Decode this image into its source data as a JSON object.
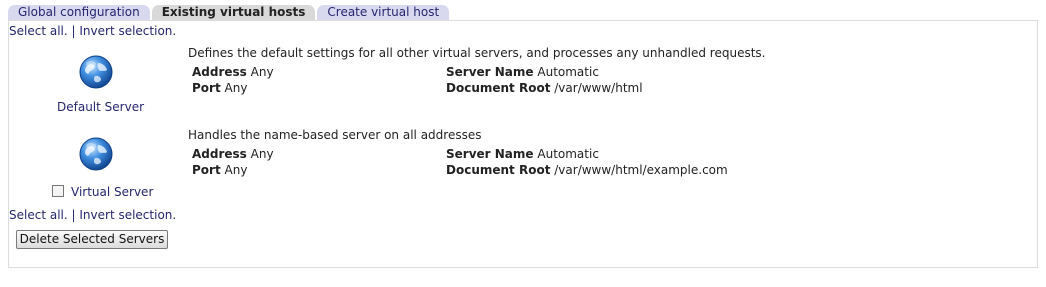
{
  "tabs": [
    {
      "label": "Global configuration",
      "active": false
    },
    {
      "label": "Existing virtual hosts",
      "active": true
    },
    {
      "label": "Create virtual host",
      "active": false
    }
  ],
  "selection_links": {
    "select_all": "Select all.",
    "separator": "|",
    "invert": "Invert selection."
  },
  "servers": [
    {
      "name": "Default Server",
      "icon": "globe-icon",
      "has_checkbox": false,
      "description": "Defines the default settings for all other virtual servers, and processes any unhandled requests.",
      "address_label": "Address",
      "address_value": "Any",
      "port_label": "Port",
      "port_value": "Any",
      "server_name_label": "Server Name",
      "server_name_value": "Automatic",
      "doc_root_label": "Document Root",
      "doc_root_value": "/var/www/html"
    },
    {
      "name": "Virtual Server",
      "icon": "globe-icon",
      "has_checkbox": true,
      "checked": false,
      "description": "Handles the name-based server on all addresses",
      "address_label": "Address",
      "address_value": "Any",
      "port_label": "Port",
      "port_value": "Any",
      "server_name_label": "Server Name",
      "server_name_value": "Automatic",
      "doc_root_label": "Document Root",
      "doc_root_value": "/var/www/html/example.com"
    }
  ],
  "actions": {
    "delete_label": "Delete Selected Servers"
  },
  "colors": {
    "link": "#26266e",
    "tab_inactive_bg": "#d8d8ef",
    "tab_active_bg": "#d9d9d9",
    "panel_border": "#dddddd"
  }
}
